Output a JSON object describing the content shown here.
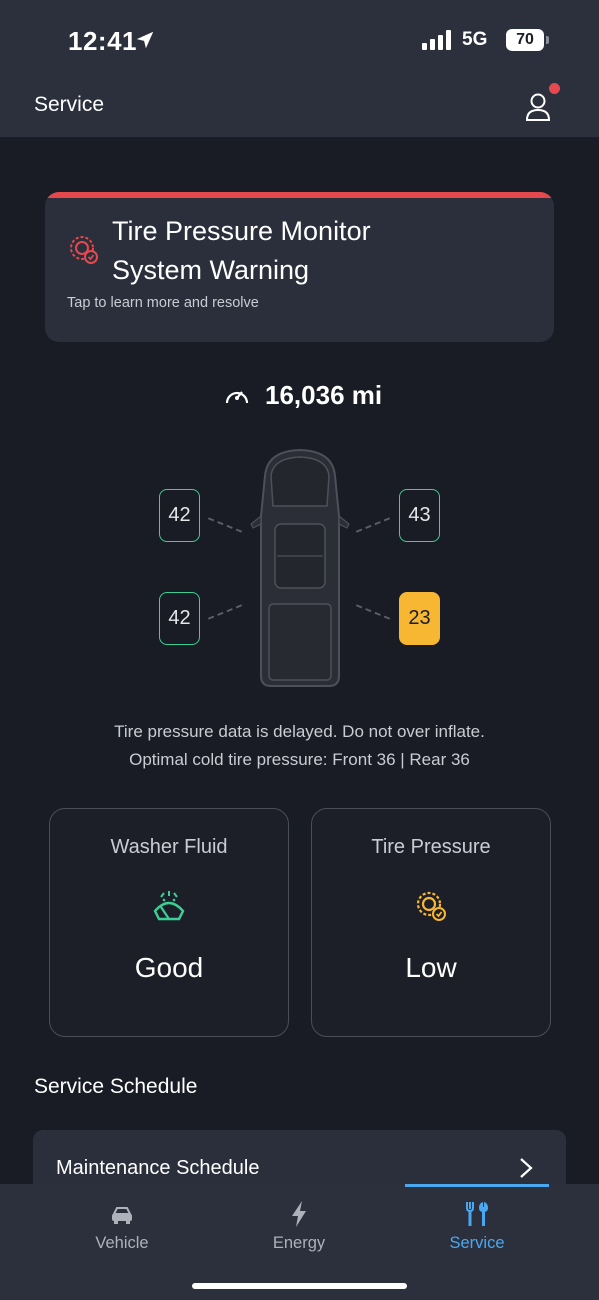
{
  "status_bar": {
    "time": "12:41",
    "network": "5G",
    "battery": "70"
  },
  "header": {
    "title": "Service"
  },
  "warning": {
    "title_line1": "Tire Pressure Monitor",
    "title_line2": "System Warning",
    "subtitle": "Tap to learn more and resolve",
    "accent_color": "#e5484d"
  },
  "odometer": {
    "value": "16,036 mi",
    "icon": "speedometer-icon"
  },
  "tires": {
    "front_left": "42",
    "front_right": "43",
    "rear_left": "42",
    "rear_right": "23",
    "ok_color": "#3ccf95",
    "low_color": "#f7b733"
  },
  "tire_notes": {
    "line1": "Tire pressure data is delayed. Do not over inflate.",
    "line2": "Optimal cold tire pressure: Front 36 | Rear 36"
  },
  "status_cards": [
    {
      "label": "Washer Fluid",
      "value": "Good",
      "icon": "washer-fluid-icon"
    },
    {
      "label": "Tire Pressure",
      "value": "Low",
      "icon": "tire-pressure-icon"
    }
  ],
  "service_schedule": {
    "title": "Service Schedule",
    "items": [
      {
        "label": "Maintenance Schedule"
      }
    ]
  },
  "bottom_nav": {
    "items": [
      {
        "label": "Vehicle",
        "icon": "car-icon"
      },
      {
        "label": "Energy",
        "icon": "lightning-icon"
      },
      {
        "label": "Service",
        "icon": "tools-icon",
        "active": true
      }
    ],
    "active_color": "#4aa8f0"
  }
}
